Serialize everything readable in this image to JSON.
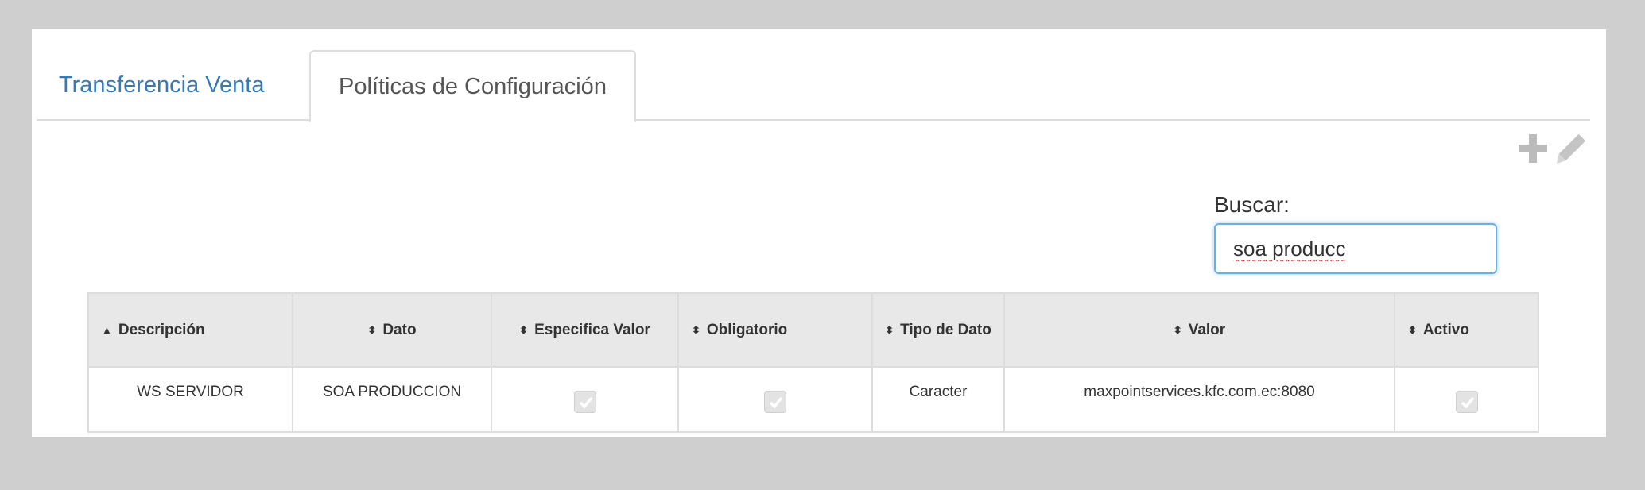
{
  "tabs": [
    {
      "label": "Transferencia Venta",
      "active": false
    },
    {
      "label": "Políticas de Configuración",
      "active": true
    }
  ],
  "toolbar": {
    "add_icon": "plus-icon",
    "edit_icon": "pencil-icon",
    "icon_color": "#bbbbbb"
  },
  "search": {
    "label": "Buscar:",
    "value": "soa producc"
  },
  "table": {
    "headers": {
      "descripcion": "Descripción",
      "dato": "Dato",
      "especifica_valor": "Especifica Valor",
      "obligatorio": "Obligatorio",
      "tipo_dato": "Tipo de Dato",
      "valor": "Valor",
      "activo": "Activo"
    },
    "sort": {
      "descripcion": "ascending",
      "others": "unsorted"
    },
    "rows": [
      {
        "descripcion": "WS SERVIDOR",
        "dato": "SOA PRODUCCION",
        "especifica_valor": true,
        "obligatorio": true,
        "tipo_dato": "Caracter",
        "valor": "maxpointservices.kfc.com.ec:8080",
        "activo": true
      }
    ]
  },
  "colors": {
    "link": "#337ab7",
    "header_bg": "#e8e8e8",
    "border": "#dddddd",
    "focus": "#66afe9"
  }
}
